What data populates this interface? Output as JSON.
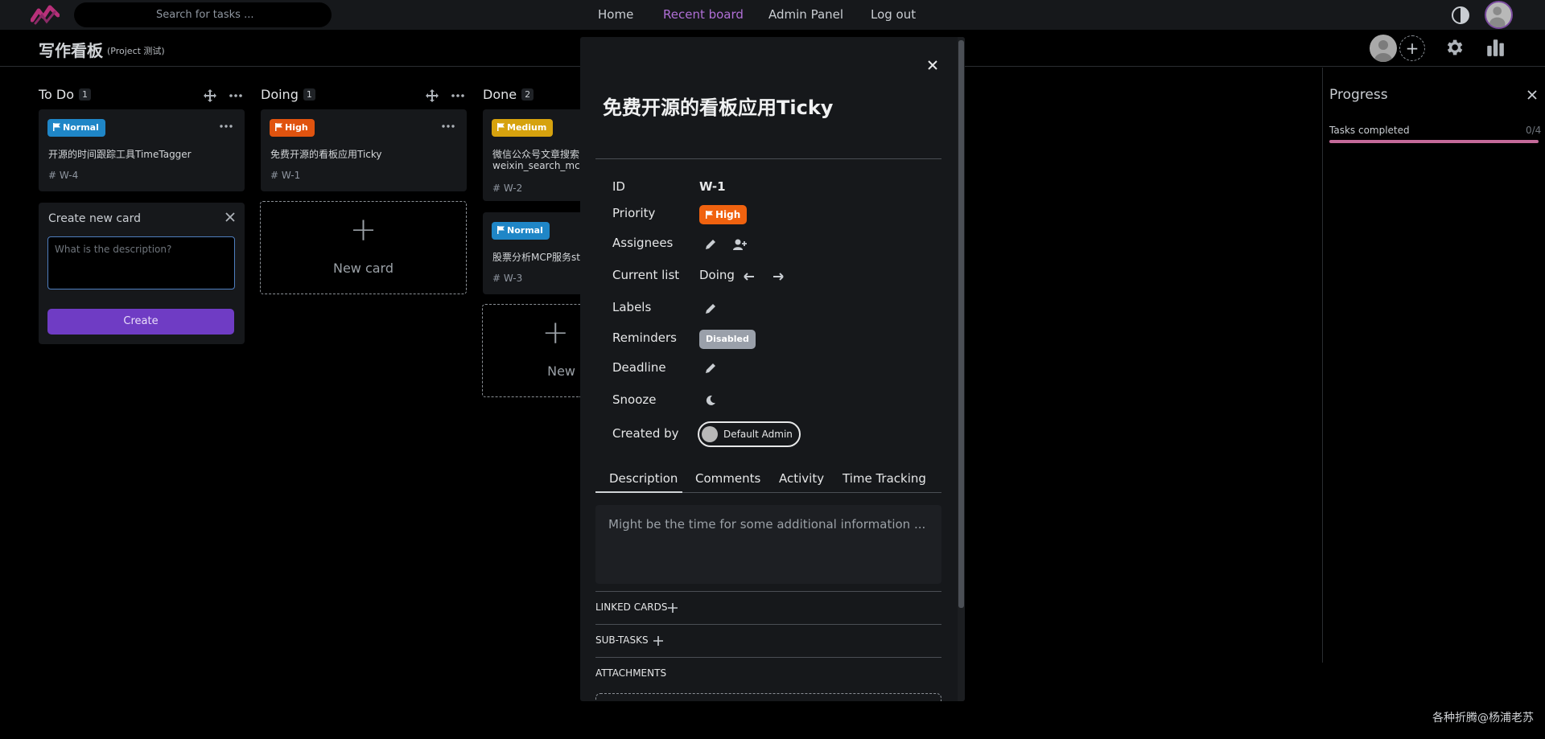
{
  "topbar": {
    "search_placeholder": "Search for tasks ...",
    "nav": [
      "Home",
      "Recent board",
      "Admin Panel",
      "Log out"
    ],
    "active_nav": "Recent board"
  },
  "board": {
    "title": "写作看板",
    "subtitle": "(Project 测试)"
  },
  "columns": [
    {
      "name": "To Do",
      "count": "1",
      "cards": [
        {
          "priority": "Normal",
          "title": "开源的时间跟踪工具TimeTagger",
          "id": "W-4"
        }
      ]
    },
    {
      "name": "Doing",
      "count": "1",
      "cards": [
        {
          "priority": "High",
          "title": "免费开源的看板应用Ticky",
          "id": "W-1"
        }
      ],
      "new_card_label": "New card"
    },
    {
      "name": "Done",
      "count": "2",
      "cards": [
        {
          "priority": "Medium",
          "title": "微信公众号文章搜索",
          "title_line2": "weixin_search_mcp",
          "id": "W-2"
        },
        {
          "priority": "Normal",
          "title": "股票分析MCP服务sto",
          "id": "W-3"
        }
      ],
      "new_card_label": "New"
    }
  ],
  "create_card": {
    "title": "Create new card",
    "placeholder": "What is the description?",
    "button": "Create"
  },
  "progress": {
    "title": "Progress",
    "label": "Tasks completed",
    "count": "0/4",
    "fraction": 0.0
  },
  "modal": {
    "title": "免费开源的看板应用Ticky",
    "labels": {
      "id": "ID",
      "priority": "Priority",
      "assignees": "Assignees",
      "current_list": "Current list",
      "labels": "Labels",
      "reminders": "Reminders",
      "deadline": "Deadline",
      "snooze": "Snooze",
      "created_by": "Created by"
    },
    "values": {
      "id": "W-1",
      "priority": "High",
      "current_list": "Doing",
      "reminders": "Disabled",
      "created_by": "Default Admin"
    },
    "tabs": [
      "Description",
      "Comments",
      "Activity",
      "Time Tracking"
    ],
    "active_tab": "Description",
    "description_placeholder": "Might be the time for some additional information ...",
    "sections": [
      "LINKED CARDS",
      "SUB-TASKS",
      "ATTACHMENTS"
    ]
  },
  "colors": {
    "normal": "#1f86c7",
    "high": "#e0530f",
    "medium": "#d6a20e",
    "accent": "#6f3cc4",
    "active_nav": "#b06fd6"
  },
  "watermark": "各种折腾@杨浦老苏"
}
